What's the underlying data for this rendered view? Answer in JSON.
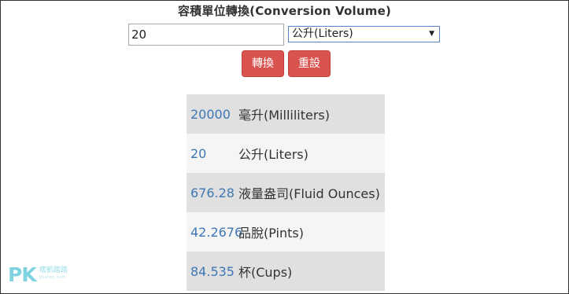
{
  "page": {
    "title": "容積單位轉換(Conversion Volume)"
  },
  "form": {
    "input_value": "20",
    "unit_selected": "公升(Liters)",
    "convert_label": "轉換",
    "reset_label": "重設"
  },
  "results": [
    {
      "value": "20000",
      "unit": "毫升(Milliliters)"
    },
    {
      "value": "20",
      "unit": "公升(Liters)"
    },
    {
      "value": "676.28",
      "unit": "液量盎司(Fluid Ounces)"
    },
    {
      "value": "42.2676",
      "unit": "品脫(Pints)"
    },
    {
      "value": "84.535",
      "unit": "杯(Cups)"
    }
  ],
  "watermark": {
    "logo": "PK",
    "cn": "痞凱踏踏",
    "en": "pkstep.com"
  },
  "colors": {
    "button": "#d9534f",
    "value_text": "#3d77b5",
    "row_dark": "#e0e0e0",
    "row_light": "#f5f5f5"
  }
}
